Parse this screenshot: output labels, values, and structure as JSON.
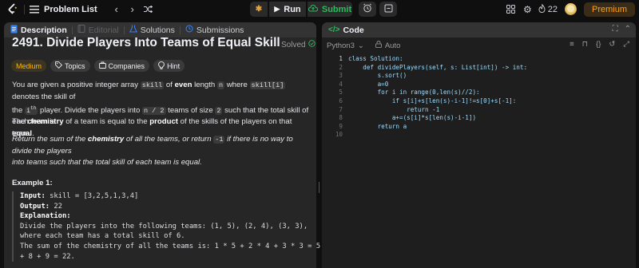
{
  "topbar": {
    "problem_list": "Problem List",
    "run": "Run",
    "submit": "Submit",
    "streak": "22",
    "premium": "Premium"
  },
  "left_tabs": {
    "description": "Description",
    "editorial": "Editorial",
    "solutions": "Solutions",
    "submissions": "Submissions"
  },
  "problem": {
    "title": "2491. Divide Players Into Teams of Equal Skill",
    "status": "Solved",
    "tags": [
      "Medium",
      "Topics",
      "Companies",
      "Hint"
    ]
  },
  "desc": {
    "p1_a": "You are given a positive integer array ",
    "p1_code1": "skill",
    "p1_b": " of ",
    "p1_bold1": "even",
    "p1_c": " length ",
    "p1_code2": "n",
    "p1_d": " where ",
    "p1_code3": "skill[i]",
    "p1_e": " denotes the skill of",
    "p1_f": "the ",
    "p1_code4": "i",
    "p1_sup": "th",
    "p1_g": " player. Divide the players into ",
    "p1_code5": "n / 2",
    "p1_h": " teams of size ",
    "p1_code6": "2",
    "p1_i": " such that the total skill of each team is",
    "p1_bold2": "equal",
    "p1_end": ".",
    "p2_a": "The ",
    "p2_bold1": "chemistry",
    "p2_b": " of a team is equal to the ",
    "p2_bold2": "product",
    "p2_c": " of the skills of the players on that team.",
    "p3_a": "Return the sum of the ",
    "p3_bold": "chemistry",
    "p3_b": " of all the teams, or return ",
    "p3_code": "-1",
    "p3_c": " if there is no way to divide the players",
    "p3_d": "into teams such that the total skill of each team is equal."
  },
  "example": {
    "heading": "Example 1:",
    "input_label": "Input:",
    "input_value": " skill = [3,2,5,1,3,4]",
    "output_label": "Output:",
    "output_value": " 22",
    "explanation_label": "Explanation:",
    "exp1": "Divide the players into the following teams: (1, 5), (2, 4), (3, 3),",
    "exp2": "where each team has a total skill of 6.",
    "exp3": "The sum of the chemistry of all the teams is: 1 * 5 + 2 * 4 + 3 * 3 = 5",
    "exp4": "+ 8 + 9 = 22."
  },
  "code_panel": {
    "tab": "Code",
    "language": "Python3",
    "autosave": "Auto",
    "line_numbers": [
      "1",
      "2",
      "3",
      "4",
      "5",
      "6",
      "7",
      "8",
      "9",
      "10"
    ],
    "lines": [
      "class Solution:",
      "    def dividePlayers(self, s: List[int]) -> int:",
      "        s.sort()",
      "        a=0",
      "        for i in range(0,len(s)//2):",
      "            if s[i]+s[len(s)-i-1]!=s[0]+s[-1]:",
      "                return -1",
      "            a+=(s[i]*s[len(s)-i-1])",
      "        return a",
      ""
    ]
  },
  "colors": {
    "accent": "#ffa116",
    "submit": "#2cbb5d",
    "medium": "#ffb800"
  }
}
